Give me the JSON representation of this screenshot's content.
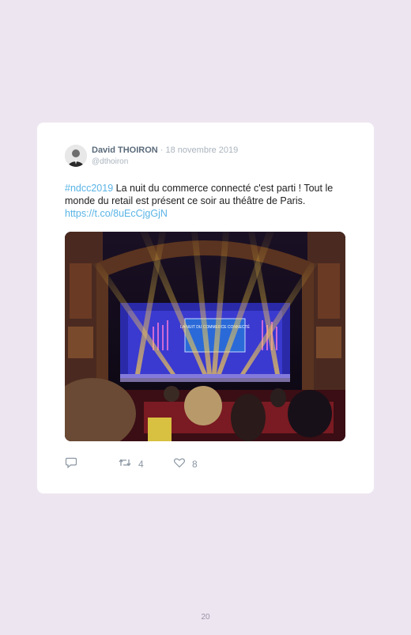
{
  "tweet": {
    "author_name": "David THOIRON",
    "separator": " · ",
    "date": "18 novembre 2019",
    "handle": "@dthoiron",
    "hashtag": "#ndcc2019",
    "body": " La nuit du commerce connecté c'est parti ! Tout le monde du retail est présent ce soir au théâtre de Paris.",
    "link": "https://t.co/8uEcCjgGjN",
    "photo_screen_text": "LA NUIT DU COMMERCE CONNECTÉ",
    "retweet_count": "4",
    "like_count": "8"
  },
  "icons": {
    "reply": "speech-bubble-icon",
    "retweet": "retweet-arrows-icon",
    "like": "heart-icon"
  },
  "colors": {
    "page_background": "#ede6f1",
    "link": "#5ab4e6",
    "muted": "#aab4be"
  },
  "page": {
    "number": "20"
  }
}
